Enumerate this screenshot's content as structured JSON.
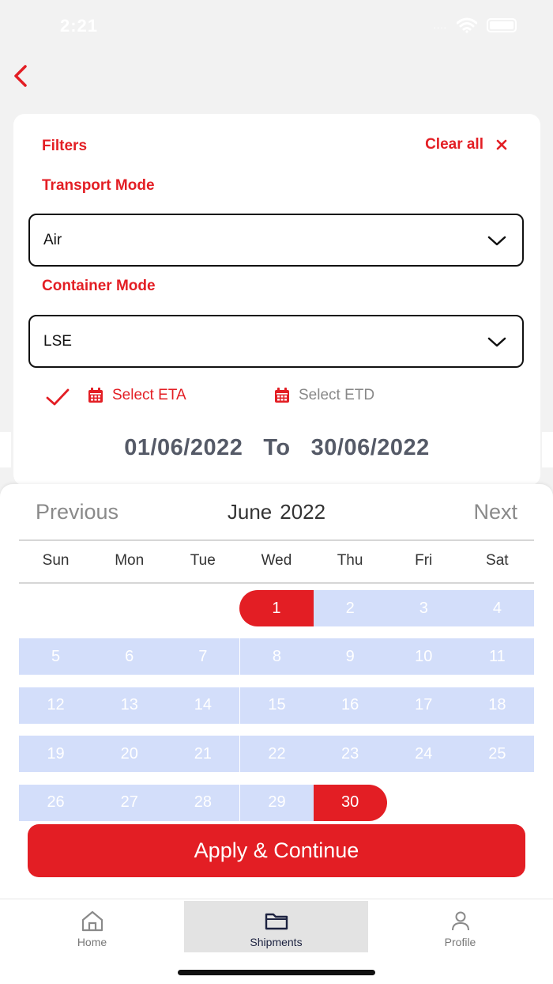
{
  "status_bar": {
    "time": "2:21",
    "signal": "....",
    "wifi_icon": "wifi-icon",
    "battery_icon": "battery-icon"
  },
  "header": {
    "back_icon": "chevron-left-icon"
  },
  "filters": {
    "title": "Filters",
    "clear_all": "Clear all",
    "clear_icon": "close-icon",
    "transport_mode": {
      "label": "Transport Mode",
      "value": "Air"
    },
    "container_mode": {
      "label": "Container Mode",
      "value": "LSE"
    },
    "date_type": {
      "selected": "eta",
      "eta_label": "Select ETA",
      "etd_label": "Select ETD"
    },
    "date_range": {
      "from": "01/06/2022",
      "to_label": "To",
      "to": "30/06/2022"
    }
  },
  "calendar": {
    "prev_label": "Previous",
    "next_label": "Next",
    "month": "June",
    "year": "2022",
    "weekdays": [
      "Sun",
      "Mon",
      "Tue",
      "Wed",
      "Thu",
      "Fri",
      "Sat"
    ],
    "first_weekday_index": 3,
    "days_in_month": 30,
    "range_start": 1,
    "range_end": 30
  },
  "actions": {
    "apply_label": "Apply & Continue"
  },
  "tab_bar": {
    "items": [
      {
        "label": "Home",
        "icon": "home-icon"
      },
      {
        "label": "Shipments",
        "icon": "folder-icon"
      },
      {
        "label": "Profile",
        "icon": "user-icon"
      }
    ],
    "active": "Shipments"
  },
  "colors": {
    "accent": "#e31e24",
    "range": "#d3defa",
    "date_text": "#555a67",
    "muted": "#8a8a8a"
  }
}
